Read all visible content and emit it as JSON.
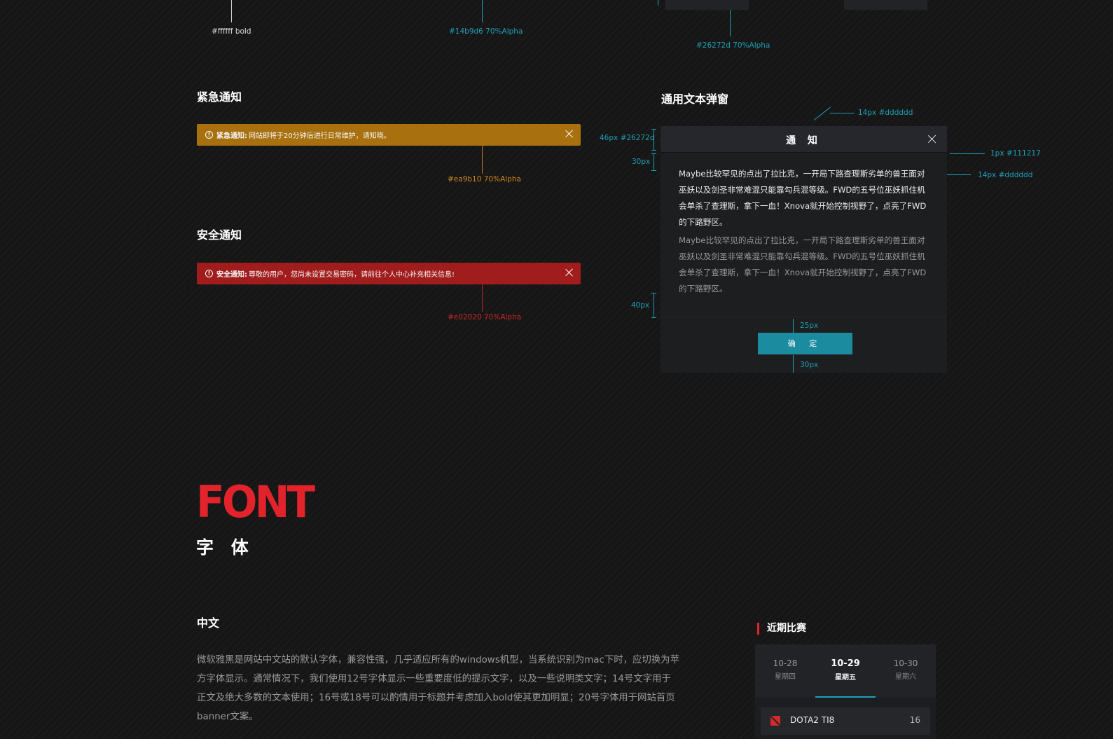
{
  "top_annotations": {
    "white_bold": "#ffffff  bold",
    "cyan_alpha": "#14b9d6  70%Alpha",
    "gray_alpha": "#26272d  70%Alpha"
  },
  "urgent": {
    "section_title": "紧急通知",
    "label": "紧急通知:",
    "message": "网站即将于20分钟后进行日常维护，请知晓。",
    "color_note": "#ea9b10  70%Alpha",
    "bar_color": "#a8700f"
  },
  "security": {
    "section_title": "安全通知",
    "label": "安全通知:",
    "message": "尊敬的用户，您尚未设置交易密码，请前往个人中心补充相关信息!",
    "color_note": "#e02020  70%Alpha",
    "bar_color": "#a11c1c"
  },
  "dialog": {
    "section_title": "通用文本弹窗",
    "title": "通 知",
    "paragraph_1": "Maybe比较罕见的点出了拉比克，一开局下路查理斯劣单的兽王面对巫妖以及剑圣非常难混只能靠勾兵混等级。FWD的五号位巫妖抓住机会单杀了查理斯，拿下一血！Xnova就开始控制视野了，点亮了FWD的下路野区。",
    "paragraph_2": "Maybe比较罕见的点出了拉比克，一开局下路查理斯劣单的兽王面对巫妖以及剑圣非常难混只能靠勾兵混等级。FWD的五号位巫妖抓住机会单杀了查理斯，拿下一血！Xnova就开始控制视野了，点亮了FWD的下路野区。",
    "button": "确 定",
    "notes": {
      "title_font": "14px  #dddddd",
      "header_height": "46px #26272d",
      "border": "1px  #111217",
      "body_font": "14px  #dddddd",
      "gap_30a": "30px",
      "gap_30b": "30px",
      "gap_40": "40px",
      "gap_25": "25px",
      "gap_30c": "30px"
    }
  },
  "font_section": {
    "logo": "FONT",
    "title_cn": "字 体",
    "subsection": "中文",
    "description": "微软雅黑是网站中文站的默认字体，兼容性强，几乎适应所有的windows机型，当系统识别为mac下时，应切换为苹方字体显示。通常情况下，我们使用12号字体显示一些重要度低的提示文字，以及一些说明类文字；14号文字用于正文及绝大多数的文本使用；16号或18号可以酌情用于标题并考虑加入bold使其更加明显；20号字体用于网站首页banner文案。"
  },
  "recent_matches": {
    "title": "近期比赛",
    "tabs": [
      {
        "date": "10-28",
        "weekday": "星期四",
        "active": false
      },
      {
        "date": "10-29",
        "weekday": "星期五",
        "active": true
      },
      {
        "date": "10-30",
        "weekday": "星期六",
        "active": false
      }
    ],
    "rows": [
      {
        "icon": "dota2-icon",
        "name": "DOTA2 TI8",
        "count": "16"
      }
    ]
  }
}
